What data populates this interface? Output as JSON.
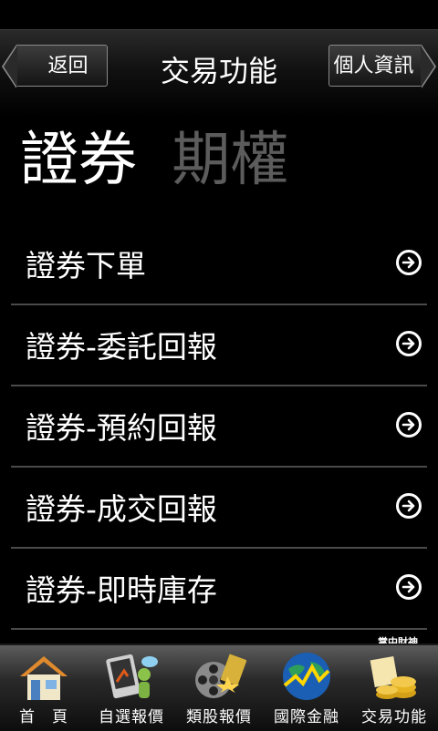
{
  "header": {
    "back_label": "返回",
    "title": "交易功能",
    "info_label": "個人資訊"
  },
  "tabs": [
    {
      "label": "證券",
      "active": true
    },
    {
      "label": "期權",
      "active": false
    }
  ],
  "menu": [
    {
      "label": "證券下單",
      "icon": "arrow-right-circle-icon"
    },
    {
      "label": "證券-委託回報",
      "icon": "arrow-right-circle-icon"
    },
    {
      "label": "證券-預約回報",
      "icon": "arrow-right-circle-icon"
    },
    {
      "label": "證券-成交回報",
      "icon": "arrow-right-circle-icon"
    },
    {
      "label": "證券-即時庫存",
      "icon": "arrow-right-circle-icon"
    }
  ],
  "brand_text": "掌中財神",
  "tabbar": [
    {
      "label": "首　頁",
      "icon": "home-icon"
    },
    {
      "label": "自選報價",
      "icon": "watchlist-icon"
    },
    {
      "label": "類股報價",
      "icon": "film-reel-icon"
    },
    {
      "label": "國際金融",
      "icon": "globe-icon"
    },
    {
      "label": "交易功能",
      "icon": "gold-coins-icon"
    }
  ],
  "colors": {
    "background": "#000000",
    "inactive_tab": "#5c5c5c",
    "divider": "#4a4a4a"
  }
}
